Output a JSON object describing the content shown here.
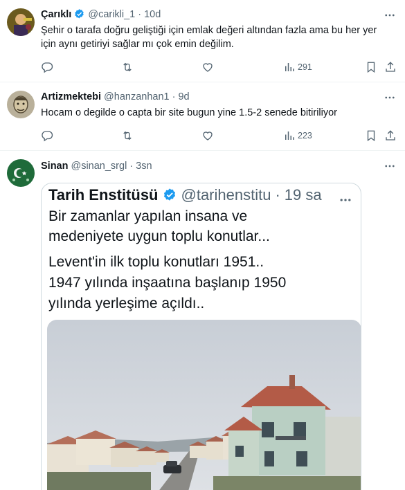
{
  "tweets": [
    {
      "name": "Çarıklı",
      "handle": "@carikli_1",
      "time": "10d",
      "verified": true,
      "text_lines": [
        "Şehir o tarafa doğru geliştiği için emlak değeri altından fazla ama bu her yer",
        "için aynı getiriyi sağlar mı çok emin değilim."
      ],
      "views": "291"
    },
    {
      "name": "Artizmektebi",
      "handle": "@hanzanhan1",
      "time": "9d",
      "verified": false,
      "text_lines": [
        "Hocam o degilde o capta bir site bugun yine 1.5-2 senede bitiriliyor"
      ],
      "views": "223"
    },
    {
      "name": "Sinan",
      "handle": "@sinan_srgl",
      "time": "3sn",
      "verified": false,
      "text_lines": []
    }
  ],
  "quoted": {
    "name": "Tarih Enstitüsü",
    "handle": "@tarihenstitu",
    "time": "19 sa",
    "verified": true,
    "text_lines": [
      "Bir zamanlar yapılan insana ve",
      "medeniyete uygun toplu konutlar...",
      "Levent'in ilk toplu konutları 1951..",
      "1947 yılında inşaatına başlanıp 1950",
      "yılında yerleşime açıldı.."
    ]
  },
  "colors": {
    "verified_blue": "#1d9bf0",
    "secondary_text": "#536471",
    "divider": "#eff3f4"
  },
  "icons": [
    "reply-icon",
    "retweet-icon",
    "like-icon",
    "views-icon",
    "bookmark-icon",
    "share-icon",
    "more-icon",
    "verified-icon"
  ]
}
